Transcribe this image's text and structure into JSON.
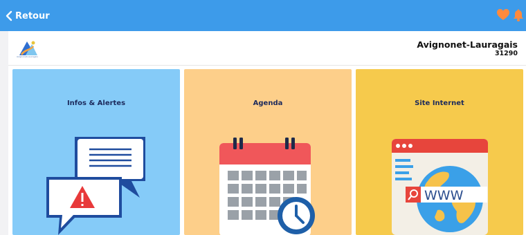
{
  "topbar": {
    "back_label": "Retour",
    "background_color": "#3d9bea",
    "icons": [
      "heart-icon",
      "bell-icon"
    ],
    "icon_color": "#ff8a3d"
  },
  "header": {
    "logo_caption": "Avignonet-Lauragais",
    "town_name": "Avignonet-Lauragais",
    "postal_code": "31290"
  },
  "tiles": [
    {
      "label": "Infos & Alertes",
      "icon": "chat-alert-icon",
      "color": "#85cbf8"
    },
    {
      "label": "Agenda",
      "icon": "calendar-clock-icon",
      "color": "#fdcf8a"
    },
    {
      "label": "Site Internet",
      "icon": "website-globe-icon",
      "color": "#f6ca4c"
    }
  ]
}
